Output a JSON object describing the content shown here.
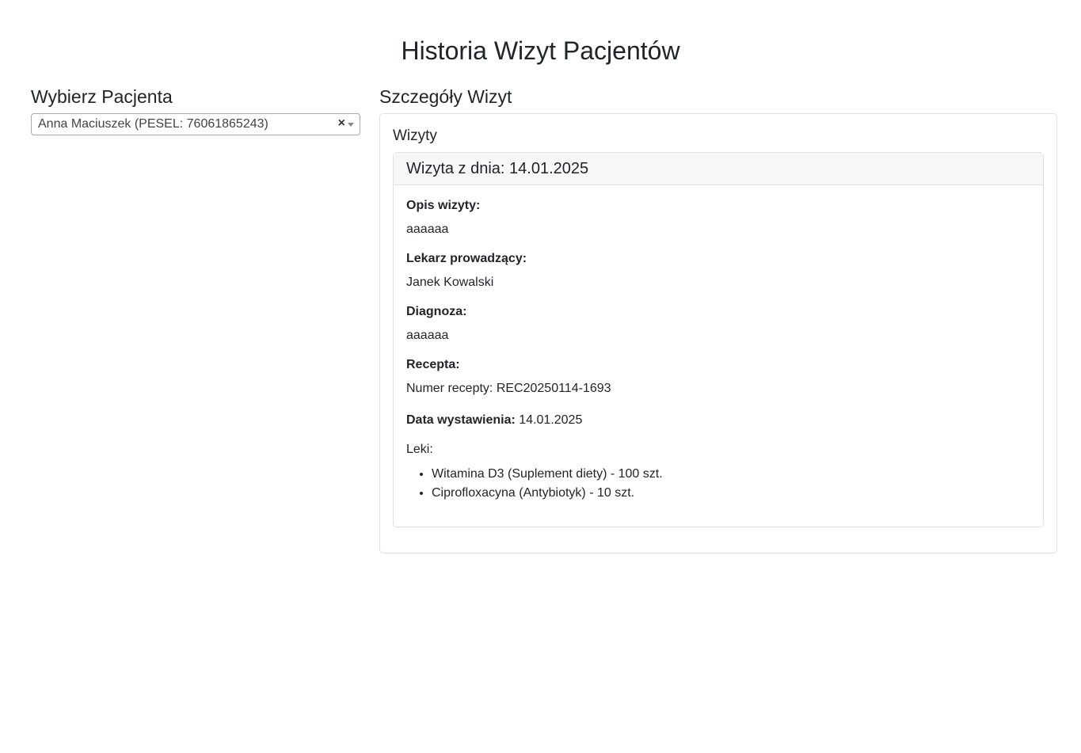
{
  "page": {
    "title": "Historia Wizyt Pacjentów"
  },
  "patient_select": {
    "heading": "Wybierz Pacjenta",
    "selected": "Anna Maciuszek (PESEL: 76061865243)",
    "clear_glyph": "×",
    "icons": [
      "close-icon",
      "chevron-down-icon"
    ]
  },
  "details": {
    "heading": "Szczegóły Wizyt",
    "card_heading": "Wizyty",
    "visit": {
      "header": "Wizyta z dnia: 14.01.2025",
      "opis_label": "Opis wizyty:",
      "opis_value": "aaaaaa",
      "lekarz_label": "Lekarz prowadzący:",
      "lekarz_value": "Janek Kowalski",
      "diagnoza_label": "Diagnoza:",
      "diagnoza_value": "aaaaaa",
      "recepta_label": "Recepta:",
      "recepta_number": "Numer recepty: REC20250114-1693",
      "data_label": "Data wystawienia:",
      "data_value": " 14.01.2025",
      "leki_label": "Leki:",
      "leki": [
        "Witamina D3 (Suplement diety) - 100 szt.",
        "Ciprofloxacyna (Antybiotyk) - 10 szt."
      ]
    }
  }
}
